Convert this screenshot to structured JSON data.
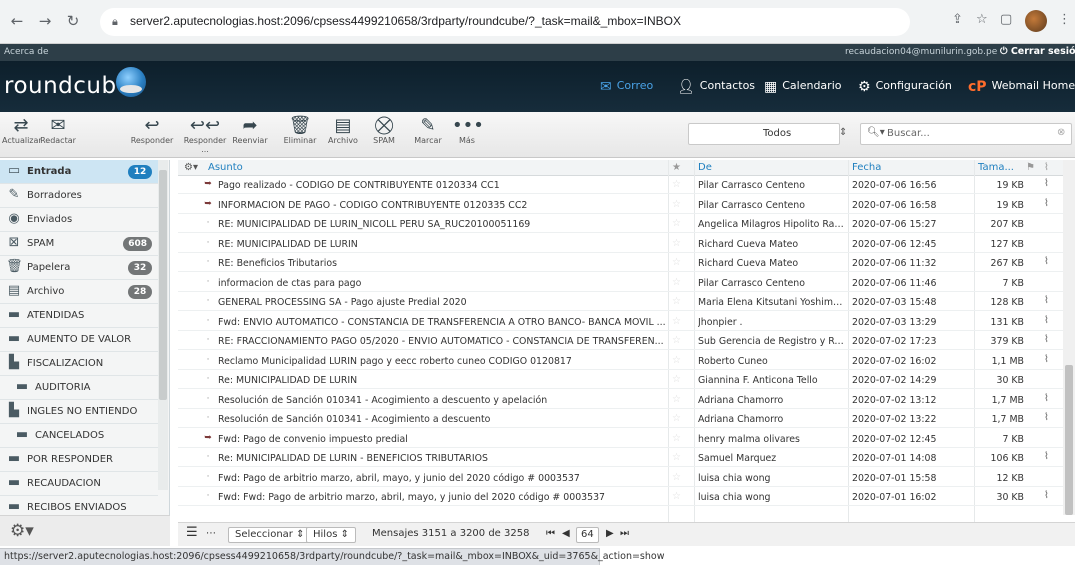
{
  "browser": {
    "url": "server2.aputecnologias.host:2096/cpsess4499210658/3rdparty/roundcube/?_task=mail&_mbox=INBOX",
    "back_icon": "arrow-left-icon",
    "forward_icon": "arrow-right-icon",
    "reload_icon": "reload-icon"
  },
  "topline": {
    "about": "Acerca de",
    "user": "recaudacion04@munilurin.gob.pe",
    "logout": "Cerrar sesión"
  },
  "header": {
    "logo": "roundcube",
    "nav": [
      {
        "label": "Correo",
        "icon": "mail-icon",
        "active": true
      },
      {
        "label": "Contactos",
        "icon": "contacts-icon",
        "active": false
      },
      {
        "label": "Calendario",
        "icon": "calendar-icon",
        "active": false
      },
      {
        "label": "Configuración",
        "icon": "gear-icon",
        "active": false
      },
      {
        "label": "Webmail Home",
        "icon": "cpanel-icon",
        "active": false
      }
    ]
  },
  "toolbar": {
    "buttons": [
      {
        "label": "Actualizar"
      },
      {
        "label": "Redactar"
      },
      {
        "label": "Responder"
      },
      {
        "label": "Responder ..."
      },
      {
        "label": "Reenviar"
      },
      {
        "label": "Eliminar"
      },
      {
        "label": "Archivo"
      },
      {
        "label": "SPAM"
      },
      {
        "label": "Marcar"
      },
      {
        "label": "Más"
      }
    ],
    "filter": "Todos",
    "search_placeholder": "Buscar..."
  },
  "sidebar": {
    "folders": [
      {
        "label": "Entrada",
        "badge": "12",
        "active": true,
        "icon": "inbox-icon"
      },
      {
        "label": "Borradores",
        "badge": "",
        "icon": "pencil-icon"
      },
      {
        "label": "Enviados",
        "badge": "",
        "icon": "sent-icon"
      },
      {
        "label": "SPAM",
        "badge": "608",
        "icon": "spam-icon"
      },
      {
        "label": "Papelera",
        "badge": "32",
        "icon": "trash-icon"
      },
      {
        "label": "Archivo",
        "badge": "28",
        "icon": "archive-icon"
      },
      {
        "label": "ATENDIDAS",
        "badge": "",
        "icon": "folder-icon"
      },
      {
        "label": "AUMENTO DE VALOR",
        "badge": "",
        "icon": "folder-icon"
      },
      {
        "label": "FISCALIZACION",
        "badge": "",
        "icon": "folder-tree-icon"
      },
      {
        "label": "AUDITORIA",
        "badge": "",
        "icon": "folder-icon",
        "sub": true
      },
      {
        "label": "INGLES NO ENTIENDO",
        "badge": "",
        "icon": "folder-tree-icon"
      },
      {
        "label": "CANCELADOS",
        "badge": "",
        "icon": "folder-icon",
        "sub": true
      },
      {
        "label": "POR RESPONDER",
        "badge": "",
        "icon": "folder-icon"
      },
      {
        "label": "RECAUDACION",
        "badge": "",
        "icon": "folder-icon"
      },
      {
        "label": "RECIBOS ENVIADOS",
        "badge": "",
        "icon": "folder-icon"
      }
    ]
  },
  "list": {
    "headers": {
      "subject": "Asunto",
      "from": "De",
      "date": "Fecha",
      "size": "Tama..."
    },
    "rows": [
      {
        "status": "replied",
        "subject": "Pago realizado - CODIGO DE CONTRIBUYENTE 0120334 CC1",
        "from": "Pilar Carrasco Centeno",
        "date": "2020-07-06 16:56",
        "size": "19 KB",
        "attachment": true
      },
      {
        "status": "replied",
        "subject": "INFORMACION DE PAGO - CODIGO CONTRIBUYENTE 0120335 CC2",
        "from": "Pilar Carrasco Centeno",
        "date": "2020-07-06 16:58",
        "size": "19 KB",
        "attachment": true
      },
      {
        "status": "read",
        "subject": "RE: MUNICIPALIDAD DE LURIN_NICOLL PERU SA_RUC20100051169",
        "from": "Angelica Milagros Hipolito Ramos",
        "date": "2020-07-06 15:27",
        "size": "207 KB",
        "attachment": false
      },
      {
        "status": "read",
        "subject": "RE: MUNICIPALIDAD DE LURIN",
        "from": "Richard Cueva Mateo",
        "date": "2020-07-06 12:45",
        "size": "127 KB",
        "attachment": false
      },
      {
        "status": "read",
        "subject": "RE: Beneficios Tributarios",
        "from": "Richard Cueva Mateo",
        "date": "2020-07-06 11:32",
        "size": "267 KB",
        "attachment": true
      },
      {
        "status": "read",
        "subject": "informacion de ctas para pago",
        "from": "Pilar Carrasco Centeno",
        "date": "2020-07-06 11:46",
        "size": "7 KB",
        "attachment": false
      },
      {
        "status": "read",
        "subject": "GENERAL PROCESSING SA - Pago ajuste Predial 2020",
        "from": "Maria Elena Kitsutani Yoshimoto",
        "date": "2020-07-03 15:48",
        "size": "128 KB",
        "attachment": true
      },
      {
        "status": "read",
        "subject": "Fwd: ENVIO AUTOMATICO - CONSTANCIA DE TRANSFERENCIA A OTRO BANCO- BANCA MOVIL ...",
        "from": "Jhonpier .",
        "date": "2020-07-03 13:29",
        "size": "131 KB",
        "attachment": true
      },
      {
        "status": "read",
        "subject": "RE: FRACCIONAMIENTO PAGO 05/2020 - ENVIO AUTOMATICO - CONSTANCIA DE TRANSFEREN...",
        "from": "Sub Gerencia de Registro y Rec...",
        "date": "2020-07-02 17:23",
        "size": "379 KB",
        "attachment": true
      },
      {
        "status": "read",
        "subject": "Reclamo Municipalidad LURIN pago y eecc roberto cuneo CODIGO 0120817",
        "from": "Roberto Cuneo",
        "date": "2020-07-02 16:02",
        "size": "1,1 MB",
        "attachment": true
      },
      {
        "status": "read",
        "subject": "Re: MUNICIPALIDAD DE LURIN",
        "from": "Giannina F. Anticona Tello",
        "date": "2020-07-02 14:29",
        "size": "30 KB",
        "attachment": false
      },
      {
        "status": "read",
        "subject": "Resolución de Sanción 010341 - Acogimiento a descuento y apelación",
        "from": "Adriana Chamorro",
        "date": "2020-07-02 13:12",
        "size": "1,7 MB",
        "attachment": true
      },
      {
        "status": "read",
        "subject": "Resolución de Sanción 010341 - Acogimiento a descuento",
        "from": "Adriana Chamorro",
        "date": "2020-07-02 13:22",
        "size": "1,7 MB",
        "attachment": true
      },
      {
        "status": "replied",
        "subject": "Fwd: Pago de convenio impuesto predial",
        "from": "henry malma olivares",
        "date": "2020-07-02 12:45",
        "size": "7 KB",
        "attachment": false
      },
      {
        "status": "read",
        "subject": "Re: MUNICIPALIDAD DE LURIN - BENEFICIOS TRIBUTARIOS",
        "from": "Samuel Marquez",
        "date": "2020-07-01 14:08",
        "size": "106 KB",
        "attachment": true
      },
      {
        "status": "read",
        "subject": "Fwd: Pago de arbitrio marzo, abril, mayo, y junio del 2020 código # 0003537",
        "from": "luisa chia wong",
        "date": "2020-07-01 15:58",
        "size": "12 KB",
        "attachment": false
      },
      {
        "status": "read",
        "subject": "Fwd: Fwd: Pago de arbitrio marzo, abril, mayo, y junio del 2020 código # 0003537",
        "from": "luisa chia wong",
        "date": "2020-07-01 16:02",
        "size": "30 KB",
        "attachment": true
      }
    ]
  },
  "footer": {
    "select": "Seleccionar",
    "threads": "Hilos",
    "count": "Mensajes 3151 a 3200 de 3258",
    "page": "64"
  },
  "status_url": "https://server2.aputecnologias.host:2096/cpsess4499210658/3rdparty/roundcube/?_task=mail&_mbox=INBOX&_uid=3765&_action=show"
}
